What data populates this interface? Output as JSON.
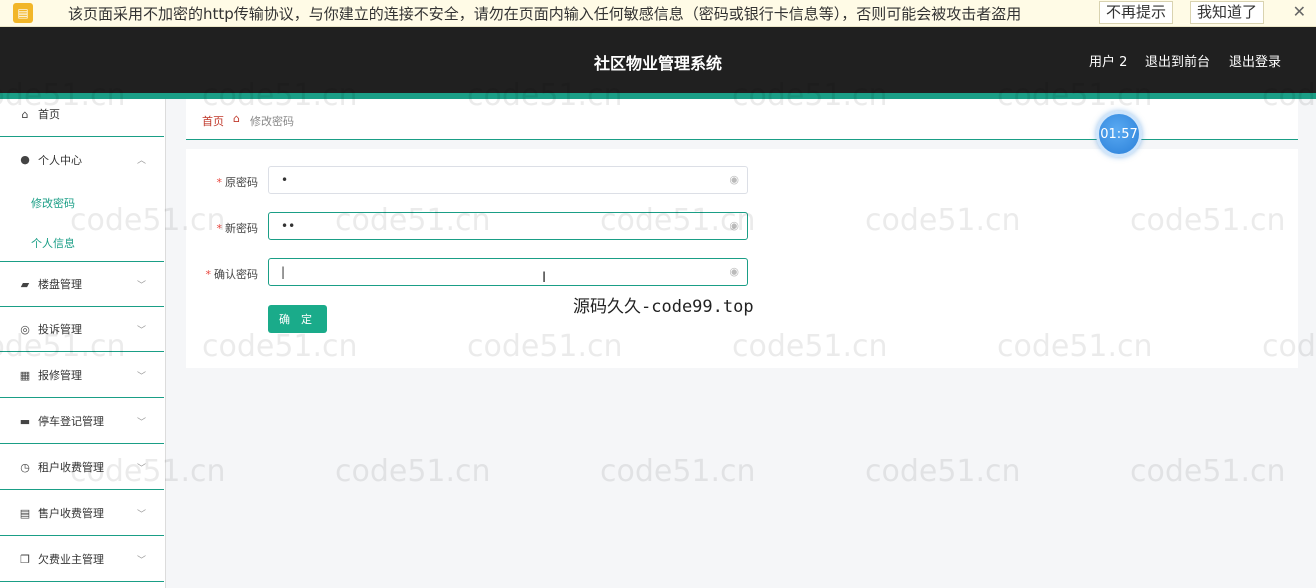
{
  "warning": {
    "text": "该页面采用不加密的http传输协议，与你建立的连接不安全，请勿在页面内输入任何敏感信息（密码或银行卡信息等），否则可能会被攻击者盗用",
    "btn_no_remind": "不再提示",
    "btn_ok": "我知道了",
    "close": "✕"
  },
  "header": {
    "title": "社区物业管理系统",
    "user": "用户 2",
    "to_front": "退出到前台",
    "logout": "退出登录"
  },
  "sidebar": {
    "items": [
      {
        "label": "首页",
        "icon": "home-icon"
      },
      {
        "label": "个人中心",
        "icon": "user-icon"
      },
      {
        "label": "楼盘管理",
        "icon": "building-icon"
      },
      {
        "label": "投诉管理",
        "icon": "complaint-icon"
      },
      {
        "label": "报修管理",
        "icon": "grid-icon"
      },
      {
        "label": "停车登记管理",
        "icon": "car-icon"
      },
      {
        "label": "租户收费管理",
        "icon": "clock-icon"
      },
      {
        "label": "售户收费管理",
        "icon": "printer-icon"
      },
      {
        "label": "欠费业主管理",
        "icon": "copy-icon"
      }
    ],
    "sub_items": [
      "修改密码",
      "个人信息"
    ]
  },
  "breadcrumb": {
    "home": "首页",
    "current": "修改密码"
  },
  "form": {
    "fields": [
      {
        "label": "原密码",
        "value": "•"
      },
      {
        "label": "新密码",
        "value": "••"
      },
      {
        "label": "确认密码",
        "value": "|"
      }
    ],
    "submit": "确 定"
  },
  "timer": "01:57",
  "overlay": "源码久久-code99.top",
  "watermark": "code51.cn"
}
